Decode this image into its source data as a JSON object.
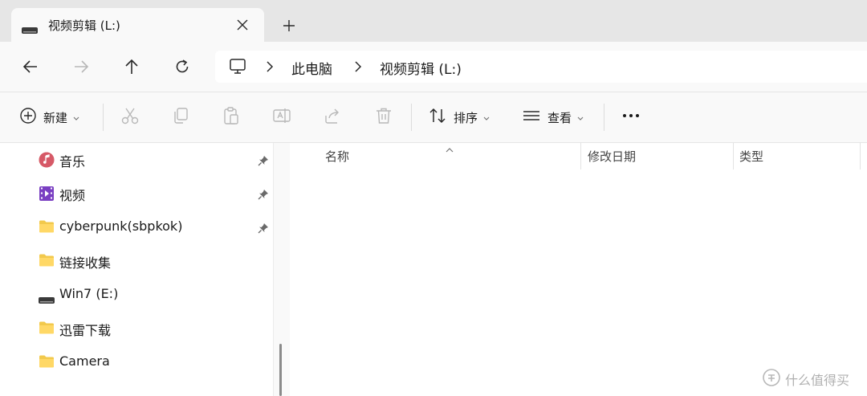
{
  "tab": {
    "title": "视频剪辑 (L:)",
    "drive_icon": "drive-icon",
    "close_icon": "close-icon",
    "newtab_icon": "plus-icon"
  },
  "nav": {
    "back_icon": "arrow-left-icon",
    "forward_icon": "arrow-right-icon",
    "up_icon": "arrow-up-icon",
    "refresh_icon": "refresh-icon",
    "breadcrumb": [
      "此电脑",
      "视频剪辑 (L:)"
    ]
  },
  "toolbar": {
    "new_label": "新建",
    "sort_label": "排序",
    "view_label": "查看",
    "more_label": "···",
    "icons": [
      "cut-icon",
      "copy-icon",
      "paste-icon",
      "rename-icon",
      "share-icon",
      "delete-icon"
    ]
  },
  "sidebar": {
    "items": [
      {
        "label": "音乐",
        "icon": "music-icon",
        "pinned": true
      },
      {
        "label": "视频",
        "icon": "video-icon",
        "pinned": true
      },
      {
        "label": "cyberpunk(sbpkok)",
        "icon": "folder-icon",
        "pinned": true
      },
      {
        "label": "链接收集",
        "icon": "folder-icon",
        "pinned": false
      },
      {
        "label": "Win7 (E:)",
        "icon": "drive-icon",
        "pinned": false
      },
      {
        "label": "迅雷下载",
        "icon": "folder-icon",
        "pinned": false
      },
      {
        "label": "Camera",
        "icon": "folder-icon",
        "pinned": false
      }
    ]
  },
  "columns": {
    "name": "名称",
    "date": "修改日期",
    "type": "类型"
  },
  "watermark": {
    "text": "什么值得买",
    "icon": "smzdm-logo-icon"
  },
  "colors": {
    "folder": "#f2c94c",
    "accent": "#0067c0",
    "chrome": "#f9f9f9",
    "tabstrip": "#e6e6e6"
  }
}
